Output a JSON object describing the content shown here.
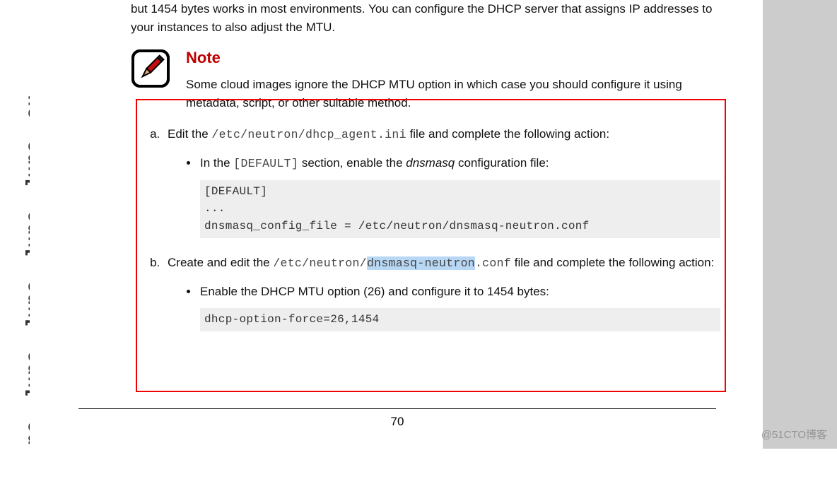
{
  "watermark": "no - Juno - Juno - Juno - Juno - ou",
  "para_top": "but 1454 bytes works in most environments. You can configure the DHCP server that assigns IP addresses to your instances to also adjust the MTU.",
  "note": {
    "heading": "Note",
    "body": "Some cloud images ignore the DHCP MTU option in which case you should configure it using metadata, script, or other suitable method."
  },
  "step_a": {
    "pre": "Edit the ",
    "path": "/etc/neutron/dhcp_agent.ini",
    "post": " file and complete the following action:",
    "bullet_pre": "In the ",
    "bullet_code": "[DEFAULT]",
    "bullet_mid": " section, enable the ",
    "bullet_em": "dnsmasq",
    "bullet_post": " configuration file:",
    "block": "[DEFAULT]\n...\ndnsmasq_config_file = /etc/neutron/dnsmasq-neutron.conf"
  },
  "step_b": {
    "pre": "Create and edit the ",
    "path_before": "/etc/neutron/",
    "path_hl": "dnsmasq-neutron",
    "path_after": ".conf",
    "post": " file and complete the following action:",
    "bullet": "Enable the DHCP MTU option (26) and configure it to 1454 bytes:",
    "block": "dhcp-option-force=26,1454"
  },
  "page_number": "70",
  "bottom_watermark": "@51CTO博客"
}
